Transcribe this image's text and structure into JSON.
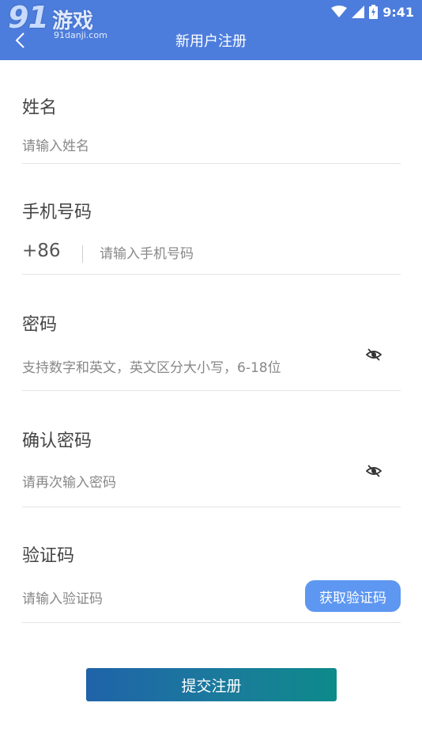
{
  "status_bar": {
    "time": "9:41"
  },
  "watermark": {
    "logo_text": "91",
    "logo_cn": "游戏",
    "site": "91danji.com"
  },
  "header": {
    "title": "新用户注册",
    "back_icon": "chevron-left-icon"
  },
  "form": {
    "name": {
      "label": "姓名",
      "placeholder": "请输入姓名"
    },
    "phone": {
      "label": "手机号码",
      "prefix": "+86",
      "placeholder": "请输入手机号码"
    },
    "password": {
      "label": "密码",
      "placeholder": "支持数字和英文，英文区分大小写，6-18位",
      "toggle_icon": "eye-off-icon"
    },
    "confirm_password": {
      "label": "确认密码",
      "placeholder": "请再次输入密码",
      "toggle_icon": "eye-off-icon"
    },
    "verification": {
      "label": "验证码",
      "placeholder": "请输入验证码",
      "button": "获取验证码"
    }
  },
  "submit": {
    "label": "提交注册"
  },
  "colors": {
    "header_bg": "#4d7ddc",
    "code_button": "#5e97f1",
    "submit_start": "#1f63a9",
    "submit_end": "#0d8a8a"
  }
}
